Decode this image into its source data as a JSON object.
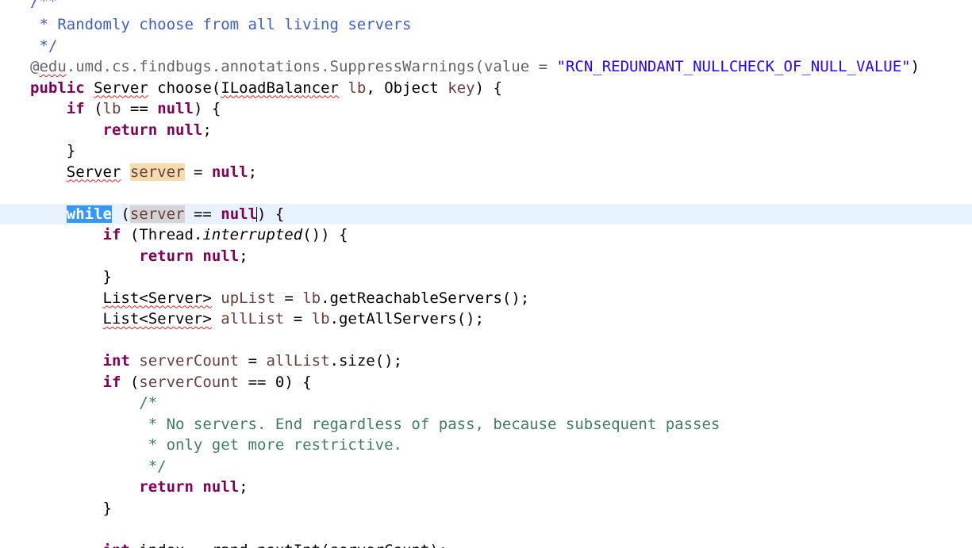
{
  "editor": {
    "lines": {
      "l01": {
        "a": "/**"
      },
      "l02": {
        "a": " * Randomly choose from all living servers"
      },
      "l03": {
        "a": " */"
      },
      "l04": {
        "a": "@",
        "b": "edu",
        "c": ".umd.cs.findbugs.annotations.SuppressWarnings(value = ",
        "d": "\"RCN_REDUNDANT_NULLCHECK_OF_NULL_VALUE\"",
        "e": ")"
      },
      "l05": {
        "a": "public",
        "b": " ",
        "c": "Server",
        "d": " choose(",
        "e": "ILoadBalancer",
        "f": " ",
        "g": "lb",
        "h": ", Object ",
        "i": "key",
        "j": ") {"
      },
      "l06": {
        "a": "    ",
        "b": "if",
        "c": " (",
        "d": "lb",
        "e": " == ",
        "f": "null",
        "g": ") {"
      },
      "l07": {
        "a": "        ",
        "b": "return",
        "c": " ",
        "d": "null",
        "e": ";"
      },
      "l08": {
        "a": "    }"
      },
      "l09": {
        "a": "    ",
        "b": "Server",
        "c": " ",
        "d": "server",
        "e": " = ",
        "f": "null",
        "g": ";"
      },
      "l10": {
        "a": ""
      },
      "l11": {
        "a": "    ",
        "b": "while",
        "c": " (",
        "d": "server",
        "e": " == ",
        "f": "null",
        "g": ") {"
      },
      "l12": {
        "a": "        ",
        "b": "if",
        "c": " (Thread.",
        "d": "interrupted",
        "e": "()) {"
      },
      "l13": {
        "a": "            ",
        "b": "return",
        "c": " ",
        "d": "null",
        "e": ";"
      },
      "l14": {
        "a": "        }"
      },
      "l15": {
        "a": "        ",
        "b": "List<Server>",
        "c": " ",
        "d": "upList",
        "e": " = ",
        "f": "lb",
        "g": ".getReachableServers();"
      },
      "l16": {
        "a": "        ",
        "b": "List<Server>",
        "c": " ",
        "d": "allList",
        "e": " = ",
        "f": "lb",
        "g": ".getAllServers();"
      },
      "l17": {
        "a": ""
      },
      "l18": {
        "a": "        ",
        "b": "int",
        "c": " ",
        "d": "serverCount",
        "e": " = ",
        "f": "allList",
        "g": ".size();"
      },
      "l19": {
        "a": "        ",
        "b": "if",
        "c": " (",
        "d": "serverCount",
        "e": " == 0) {"
      },
      "l20": {
        "a": "            /*"
      },
      "l21": {
        "a": "             * No servers. End regardless of pass, because subsequent passes"
      },
      "l22": {
        "a": "             * only get more restrictive."
      },
      "l23": {
        "a": "             */"
      },
      "l24": {
        "a": "            ",
        "b": "return",
        "c": " ",
        "d": "null",
        "e": ";"
      },
      "l25": {
        "a": "        }"
      },
      "l26": {
        "a": ""
      },
      "l27": {
        "a": "        ",
        "b": "int",
        "c": " index = rand.nextInt(serverCount);"
      }
    }
  }
}
